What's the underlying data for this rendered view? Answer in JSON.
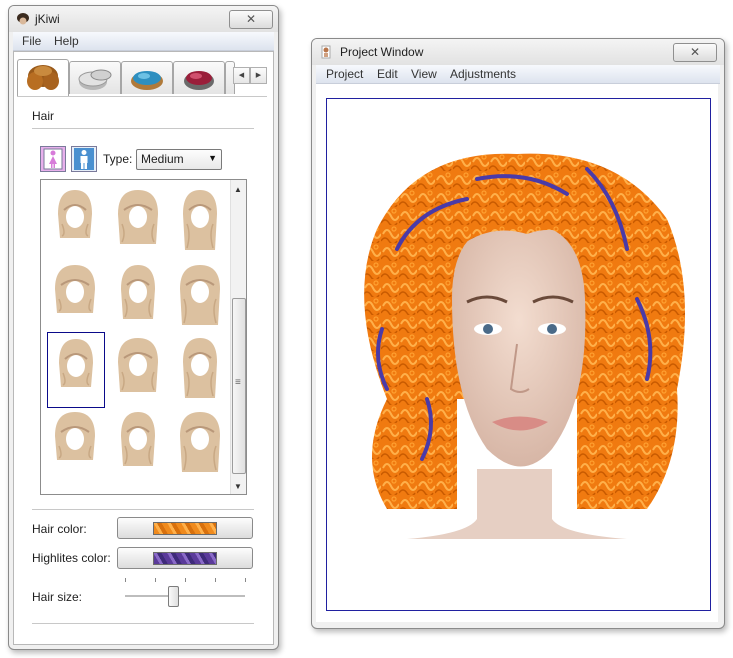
{
  "jkiwi": {
    "title": "jKiwi",
    "close_glyph": "✕",
    "menu": [
      "File",
      "Help"
    ],
    "tabs": [
      {
        "icon": "hair-icon",
        "active": true
      },
      {
        "icon": "powder-icon",
        "active": false
      },
      {
        "icon": "eyeshadow-icon",
        "active": false
      },
      {
        "icon": "blush-icon",
        "active": false
      }
    ],
    "tab_scroll_left": "◀",
    "tab_scroll_right": "▶",
    "section_title": "Hair",
    "gender_buttons": [
      {
        "icon": "female-icon",
        "selected": true
      },
      {
        "icon": "male-icon",
        "selected": false
      }
    ],
    "type_label": "Type:",
    "type_value": "Medium",
    "type_arrow": "▼",
    "hairstyles_selected_index": 6,
    "scroll_up": "▲",
    "scroll_down": "▼",
    "scroll_grip": "≡",
    "hair_color_label": "Hair color:",
    "hair_color": "#f08a1c",
    "highlites_color_label": "Highlites color:",
    "highlites_color": "#5a3a9a",
    "hair_size_label": "Hair size:",
    "hair_size_fraction": 0.39
  },
  "project": {
    "title": "Project Window",
    "close_glyph": "✕",
    "menu": [
      "Project",
      "Edit",
      "View",
      "Adjustments"
    ],
    "hair_color": "#f07a10",
    "highlight_color": "#4a3aa8"
  }
}
